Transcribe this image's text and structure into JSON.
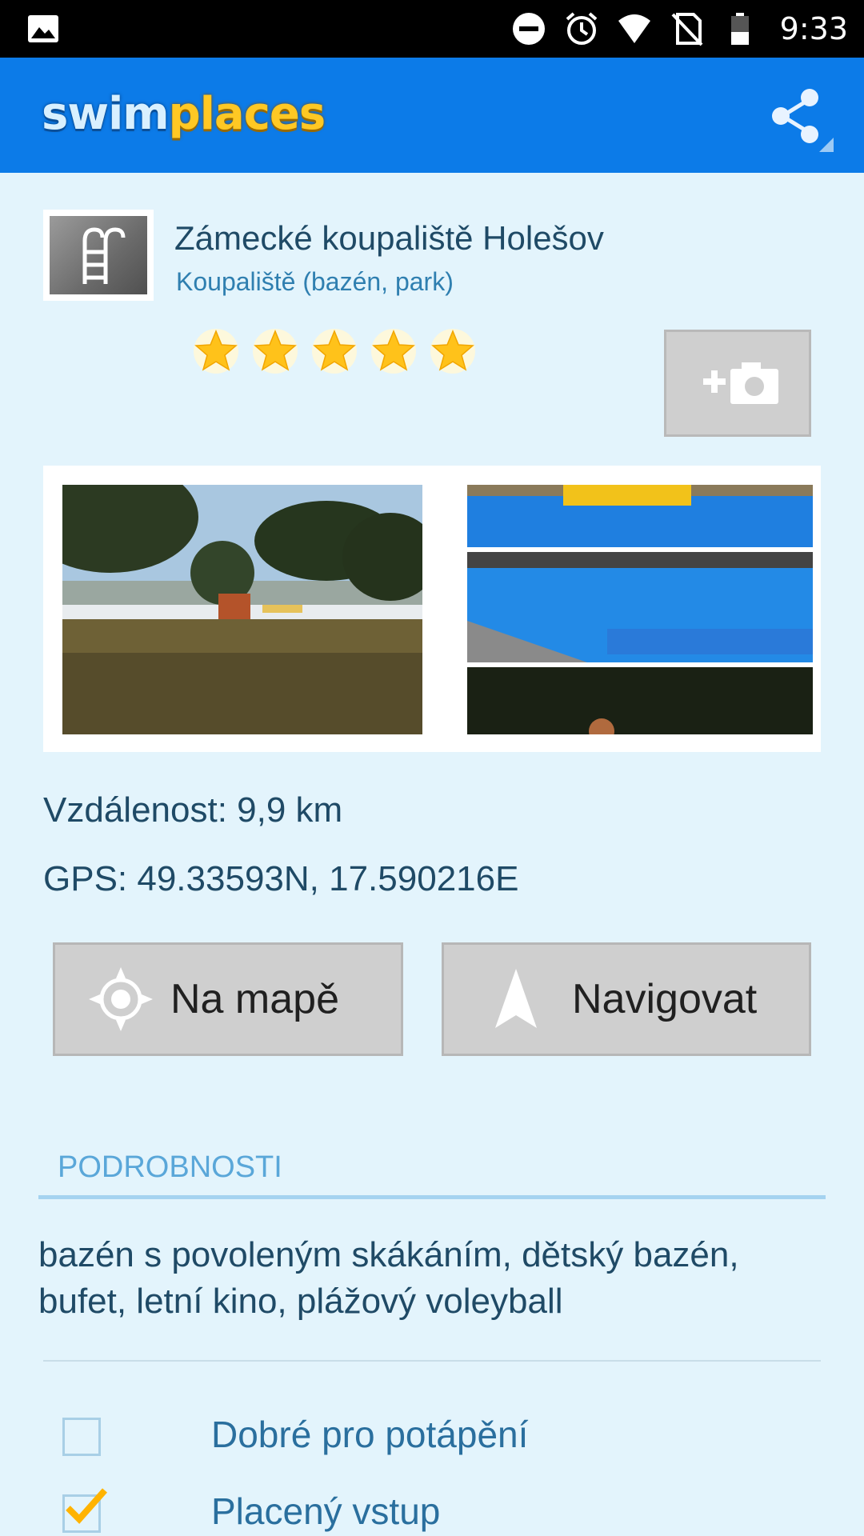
{
  "status_bar": {
    "time": "9:33",
    "icons": [
      "image-icon",
      "do-not-disturb-icon",
      "alarm-icon",
      "wifi-icon",
      "no-sim-icon",
      "battery-icon"
    ]
  },
  "app_bar": {
    "logo_part1": "swim",
    "logo_part2": "places",
    "share_icon": "share-icon",
    "colors": {
      "bar": "#0c7be8",
      "logo_swim": "#d8f0ff",
      "logo_places": "#ffc824"
    }
  },
  "place": {
    "name": "Zámecké koupaliště Holešov",
    "type": "Koupaliště (bazén, park)",
    "rating": 5,
    "rating_max": 5,
    "thumb_icon": "pool-ladder-icon",
    "add_photo_icon": "add-camera-icon"
  },
  "photos": [
    {
      "name": "photo-lawn-pool"
    },
    {
      "name": "photo-pool-collage"
    }
  ],
  "info": {
    "distance": "Vzdálenost: 9,9 km",
    "gps": "GPS: 49.33593N, 17.590216E"
  },
  "buttons": {
    "map_label": "Na mapě",
    "map_icon": "location-target-icon",
    "navigate_label": "Navigovat",
    "navigate_icon": "navigation-arrow-icon"
  },
  "details": {
    "title": "PODROBNOSTI",
    "description": "bazén s povoleným skákáním, dětský bazén, bufet, letní kino, plážový voleyball",
    "features": [
      {
        "label": "Dobré pro potápění",
        "checked": false
      },
      {
        "label": "Placený vstup",
        "checked": true
      }
    ]
  },
  "colors": {
    "background": "#e3f4fc",
    "accent": "#0c7be8",
    "star": "#ffc21a",
    "check": "#ffb300"
  }
}
